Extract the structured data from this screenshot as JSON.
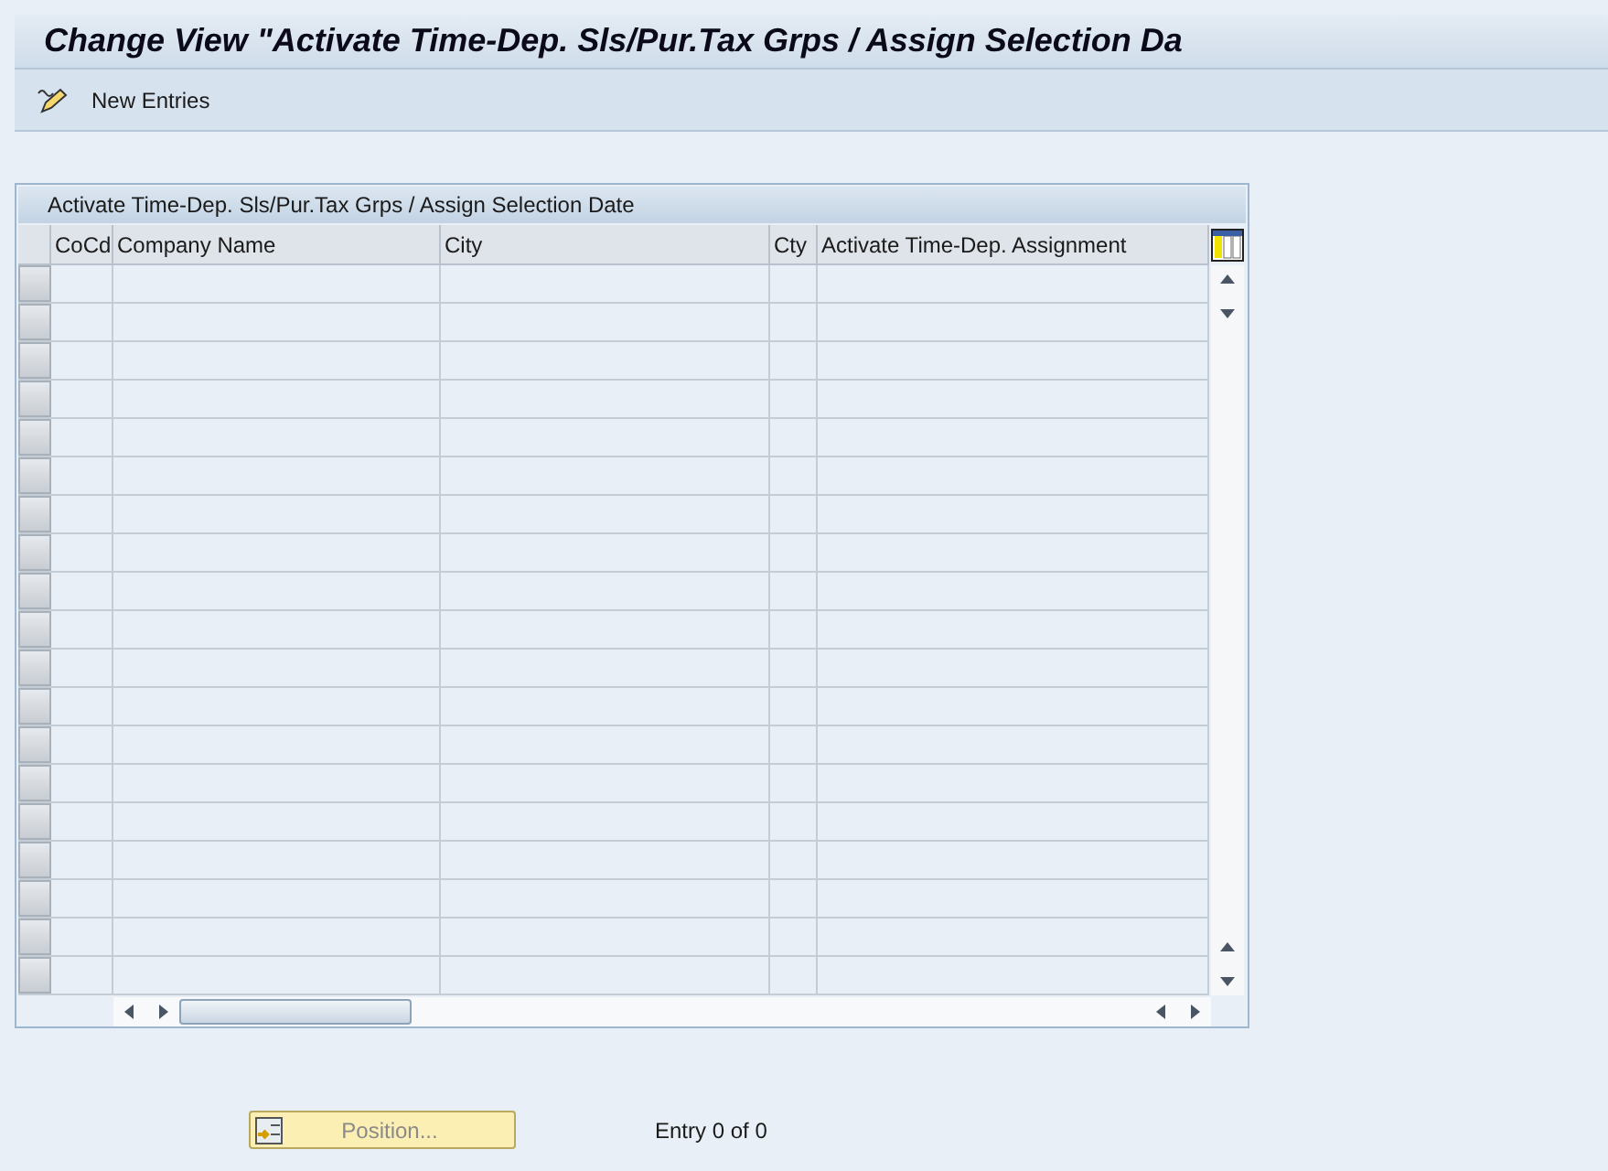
{
  "window": {
    "title": "Change View \"Activate Time-Dep. Sls/Pur.Tax Grps / Assign Selection Da"
  },
  "toolbar": {
    "items": [
      {
        "label": "New Entries"
      }
    ]
  },
  "table": {
    "title": "Activate Time-Dep. Sls/Pur.Tax Grps / Assign Selection Date",
    "columns": [
      {
        "label": "CoCd"
      },
      {
        "label": "Company Name"
      },
      {
        "label": "City"
      },
      {
        "label": "Cty"
      },
      {
        "label": "Activate Time-Dep. Assignment"
      }
    ]
  },
  "footer": {
    "position_button": {
      "label": "Position...",
      "disabled": true
    },
    "entry_count": "Entry 0 of 0"
  }
}
